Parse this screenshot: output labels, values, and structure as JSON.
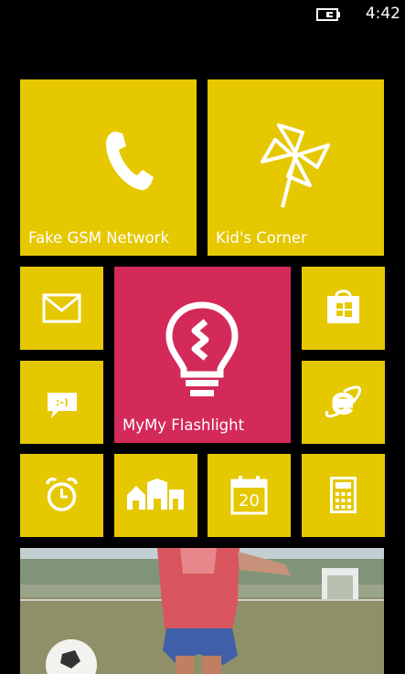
{
  "status": {
    "time": "4:42",
    "battery_icon": "battery-charging-icon"
  },
  "colors": {
    "accent": "#e5c800",
    "highlight_tile": "#d32a5a",
    "background": "#000000",
    "foreground": "#ffffff"
  },
  "tiles": {
    "fake_gsm": {
      "label": "Fake GSM Network",
      "icon": "phone-icon"
    },
    "kids_corner": {
      "label": "Kid's Corner",
      "icon": "pinwheel-icon"
    },
    "messaging": {
      "icon": "mail-icon"
    },
    "flashlight": {
      "label": "MyMy Flashlight",
      "icon": "lightbulb-icon"
    },
    "store": {
      "icon": "store-icon"
    },
    "chat": {
      "icon": "chat-icon"
    },
    "internet_explorer": {
      "icon": "internet-explorer-icon"
    },
    "alarms": {
      "icon": "alarm-clock-icon"
    },
    "local_scout": {
      "icon": "city-buildings-icon"
    },
    "calendar": {
      "icon": "calendar-icon",
      "day": "20"
    },
    "calculator": {
      "icon": "calculator-icon"
    },
    "photos": {
      "icon": "photo-hub"
    }
  }
}
